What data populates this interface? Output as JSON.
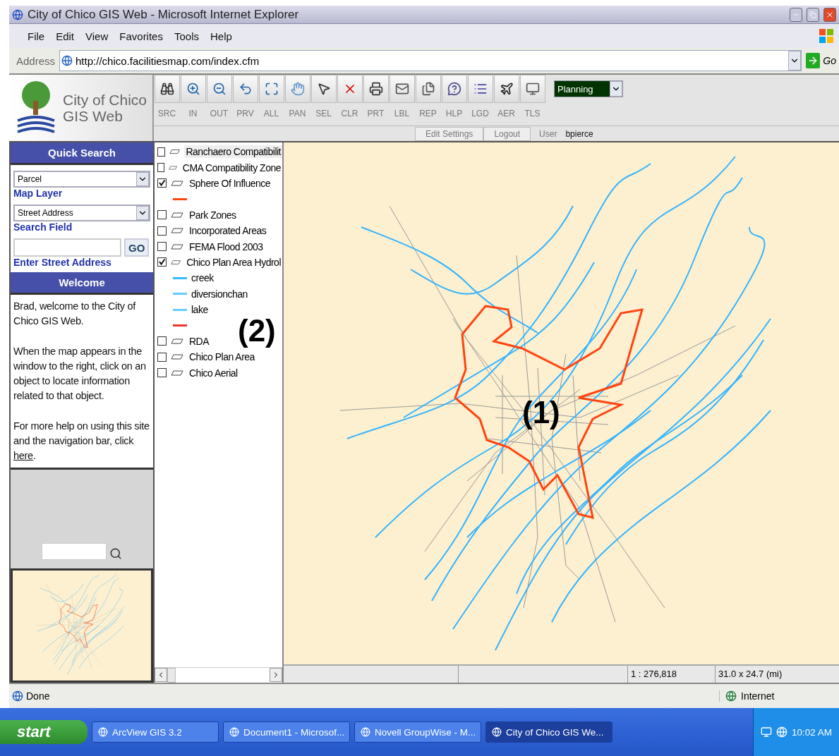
{
  "window": {
    "title": "City of Chico GIS Web - Microsoft Internet Explorer"
  },
  "menu": [
    "File",
    "Edit",
    "View",
    "Favorites",
    "Tools",
    "Help"
  ],
  "address_bar": {
    "label": "Address",
    "url": "http://chico.facilitiesmap.com/index.cfm",
    "go": "Go"
  },
  "app_header": {
    "logo_lines": [
      "City of Chico",
      "GIS Web"
    ],
    "tools": [
      {
        "label": "SRC"
      },
      {
        "label": "IN"
      },
      {
        "label": "OUT"
      },
      {
        "label": "PRV"
      },
      {
        "label": "ALL"
      },
      {
        "label": "PAN"
      },
      {
        "label": "SEL"
      },
      {
        "label": "CLR"
      },
      {
        "label": "PRT"
      },
      {
        "label": "LBL"
      },
      {
        "label": "REP"
      },
      {
        "label": "HLP"
      },
      {
        "label": "LGD"
      },
      {
        "label": "AER"
      },
      {
        "label": "TLS"
      }
    ],
    "theme_select": "Planning",
    "links": [
      "Edit Settings",
      "Logout"
    ],
    "user_label": "User",
    "user_name": "bpierce"
  },
  "quick_search": {
    "heading": "Quick Search",
    "layer_select": "Parcel",
    "layer_label": "Map Layer",
    "field_select": "Street Address",
    "field_label": "Search Field",
    "go": "GO",
    "address_label": "Enter Street Address"
  },
  "welcome": {
    "heading": "Welcome",
    "paragraphs": [
      "Brad, welcome to the City of Chico GIS Web.",
      "When the map appears in the window to the right, click on an object to locate information related to that object."
    ],
    "help_text": "For more help on using this site and the navigation bar, click",
    "help_link": "here",
    "help_after": "."
  },
  "legend": [
    {
      "kind": "layer",
      "label": "Ranchaero Compatibilit",
      "checked": false,
      "selected": true
    },
    {
      "kind": "layer",
      "label": "CMA Compatibility Zone",
      "checked": false,
      "selected": false
    },
    {
      "kind": "layer",
      "label": "Sphere Of Influence",
      "checked": true,
      "selected": false
    },
    {
      "kind": "swatch",
      "color": "#ff4411"
    },
    {
      "kind": "layer",
      "label": "Park Zones",
      "checked": false,
      "selected": false
    },
    {
      "kind": "layer",
      "label": "Incorporated Areas",
      "checked": false,
      "selected": false
    },
    {
      "kind": "layer",
      "label": "FEMA Flood 2003",
      "checked": false,
      "selected": false
    },
    {
      "kind": "layer",
      "label": "Chico Plan Area Hydrol",
      "checked": true,
      "selected": false
    },
    {
      "kind": "swatch",
      "color": "#33bbff",
      "label": "creek"
    },
    {
      "kind": "swatch",
      "color": "#66ccff",
      "label": "diversionchan"
    },
    {
      "kind": "swatch",
      "color": "#66ccff",
      "label": "lake"
    },
    {
      "kind": "swatch",
      "color": "#ee3333"
    },
    {
      "kind": "layer",
      "label": "RDA",
      "checked": false,
      "selected": false
    },
    {
      "kind": "layer",
      "label": "Chico Plan Area",
      "checked": false,
      "selected": false
    },
    {
      "kind": "layer",
      "label": "Chico Aerial",
      "checked": false,
      "selected": false
    }
  ],
  "annotations": {
    "map": "(1)",
    "legend": "(2)"
  },
  "map_status": {
    "scale": "1 : 276,818",
    "extent": "31.0 x 24.7 (mi)"
  },
  "status_bar": {
    "text": "Done",
    "zone": "Internet"
  },
  "taskbar": {
    "start": "start",
    "tasks": [
      {
        "label": "ArcView GIS 3.2",
        "selected": false
      },
      {
        "label": "Document1 - Microsof...",
        "selected": false
      },
      {
        "label": "Novell GroupWise - M...",
        "selected": false
      },
      {
        "label": "City of Chico GIS We...",
        "selected": true
      }
    ],
    "clock": "10:02 AM"
  }
}
